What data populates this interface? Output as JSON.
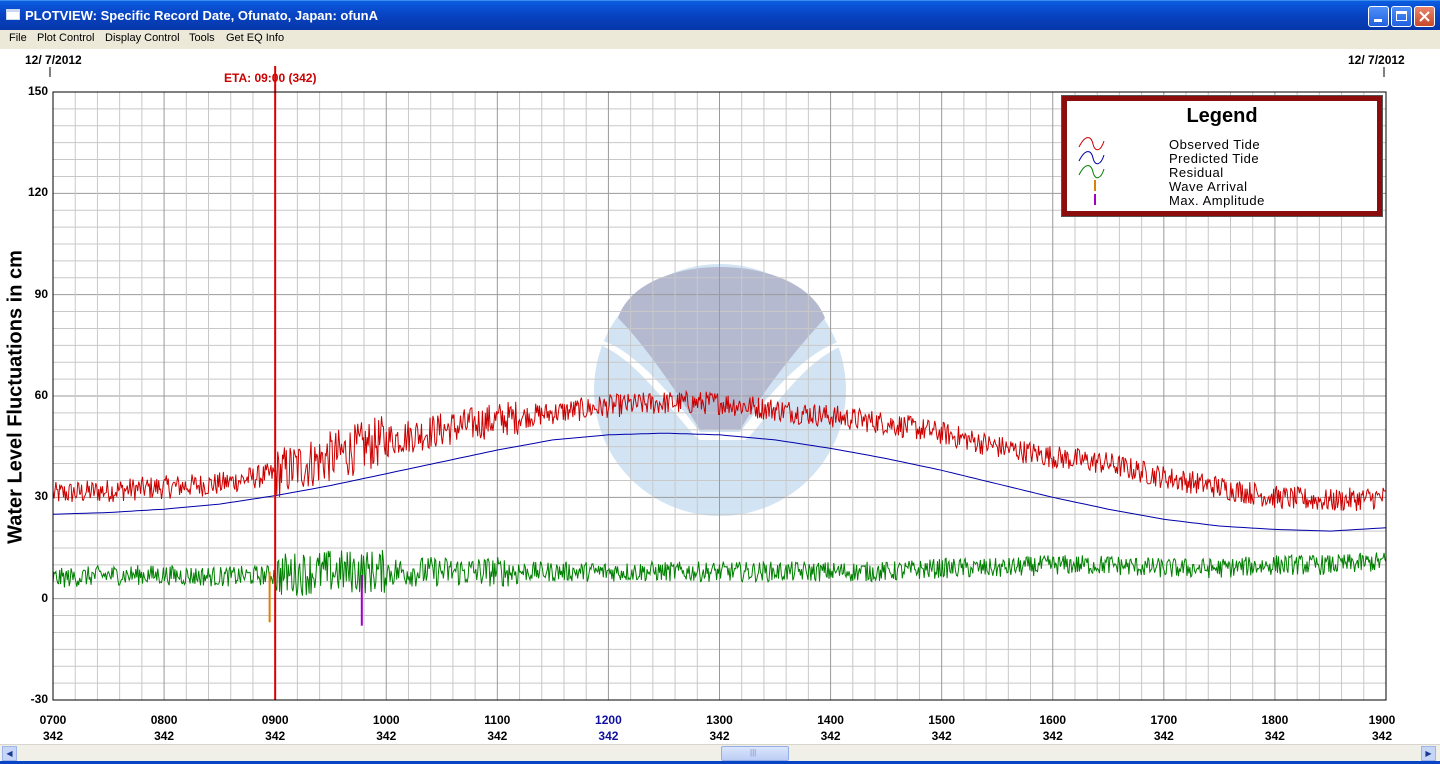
{
  "window": {
    "title": "PLOTVIEW: Specific Record Date, Ofunato, Japan: ofunA"
  },
  "menu": [
    "File",
    "Plot Control",
    "Display Control",
    "Tools",
    "Get EQ Info"
  ],
  "plot": {
    "date_left": "12/ 7/2012",
    "date_right": "12/ 7/2012",
    "eta_label": "ETA: 09:00 (342)",
    "ylabel": "Water Level Fluctuations in cm"
  },
  "legend": {
    "title": "Legend",
    "items": [
      {
        "label": "Observed Tide",
        "color": "#cc0000",
        "symbol": "wave"
      },
      {
        "label": "Predicted Tide",
        "color": "#0000aa",
        "symbol": "wave"
      },
      {
        "label": "Residual",
        "color": "#008000",
        "symbol": "wave"
      },
      {
        "label": "Wave Arrival",
        "color": "#e08000",
        "symbol": "tick"
      },
      {
        "label": "Max. Amplitude",
        "color": "#a000c0",
        "symbol": "tick"
      }
    ]
  },
  "chart_data": {
    "type": "line",
    "ylabel": "Water Level Fluctuations in cm",
    "ylim": [
      -30,
      150
    ],
    "yticks": [
      -30,
      0,
      30,
      60,
      90,
      120,
      150
    ],
    "xlim": [
      7.0,
      19.0
    ],
    "xticks": [
      {
        "time": "0700",
        "day": "342"
      },
      {
        "time": "0800",
        "day": "342"
      },
      {
        "time": "0900",
        "day": "342"
      },
      {
        "time": "1000",
        "day": "342"
      },
      {
        "time": "1100",
        "day": "342"
      },
      {
        "time": "1200",
        "day": "342",
        "highlight": true
      },
      {
        "time": "1300",
        "day": "342"
      },
      {
        "time": "1400",
        "day": "342"
      },
      {
        "time": "1500",
        "day": "342"
      },
      {
        "time": "1600",
        "day": "342"
      },
      {
        "time": "1700",
        "day": "342"
      },
      {
        "time": "1800",
        "day": "342"
      },
      {
        "time": "1900",
        "day": "342"
      }
    ],
    "grid": true,
    "eta_hour": 9.0,
    "series": [
      {
        "name": "Predicted Tide",
        "color": "#0000aa",
        "x": [
          7.0,
          7.5,
          8.0,
          8.5,
          9.0,
          9.5,
          10.0,
          10.5,
          11.0,
          11.5,
          12.0,
          12.5,
          13.0,
          13.5,
          14.0,
          14.5,
          15.0,
          15.5,
          16.0,
          16.5,
          17.0,
          17.5,
          18.0,
          18.5,
          19.0
        ],
        "y": [
          25,
          25.5,
          26.5,
          28,
          30.5,
          33.5,
          37,
          40.5,
          44,
          47,
          48.5,
          49,
          48.5,
          47,
          44.5,
          41.5,
          38,
          34,
          30,
          26.5,
          23.5,
          21.5,
          20.5,
          20,
          21
        ]
      },
      {
        "name": "Observed Tide",
        "color": "#cc0000",
        "x": [
          7.0,
          7.5,
          8.0,
          8.5,
          9.0,
          9.5,
          10.0,
          10.5,
          11.0,
          11.5,
          12.0,
          12.5,
          13.0,
          13.5,
          14.0,
          14.5,
          15.0,
          15.5,
          16.0,
          16.5,
          17.0,
          17.5,
          18.0,
          18.5,
          19.0
        ],
        "y": [
          31,
          32,
          33,
          34,
          37,
          42,
          47,
          50,
          53,
          55,
          57,
          58,
          58,
          56,
          54,
          52,
          49,
          45,
          42,
          40,
          36,
          33,
          30,
          29,
          30
        ],
        "noise": 3.5
      },
      {
        "name": "Residual",
        "color": "#008000",
        "x": [
          7.0,
          7.5,
          8.0,
          8.5,
          9.0,
          9.5,
          10.0,
          10.5,
          11.0,
          11.5,
          12.0,
          12.5,
          13.0,
          13.5,
          14.0,
          14.5,
          15.0,
          15.5,
          16.0,
          16.5,
          17.0,
          17.5,
          18.0,
          18.5,
          19.0
        ],
        "y": [
          6,
          7,
          7,
          6.5,
          7,
          8,
          8,
          8,
          8,
          8,
          8,
          8,
          8,
          8,
          8,
          8,
          9,
          9,
          10,
          10,
          9,
          9,
          10,
          10,
          11
        ],
        "noise": 3.0
      }
    ],
    "markers": [
      {
        "name": "Wave Arrival",
        "color": "#e08000",
        "x": 8.95,
        "y": [
          -7,
          8
        ]
      },
      {
        "name": "Max. Amplitude",
        "color": "#a000c0",
        "x": 9.78,
        "y": [
          -8,
          7
        ]
      }
    ]
  },
  "scrollbar": {
    "left": "◀",
    "right": "▶",
    "grip": "|||"
  }
}
